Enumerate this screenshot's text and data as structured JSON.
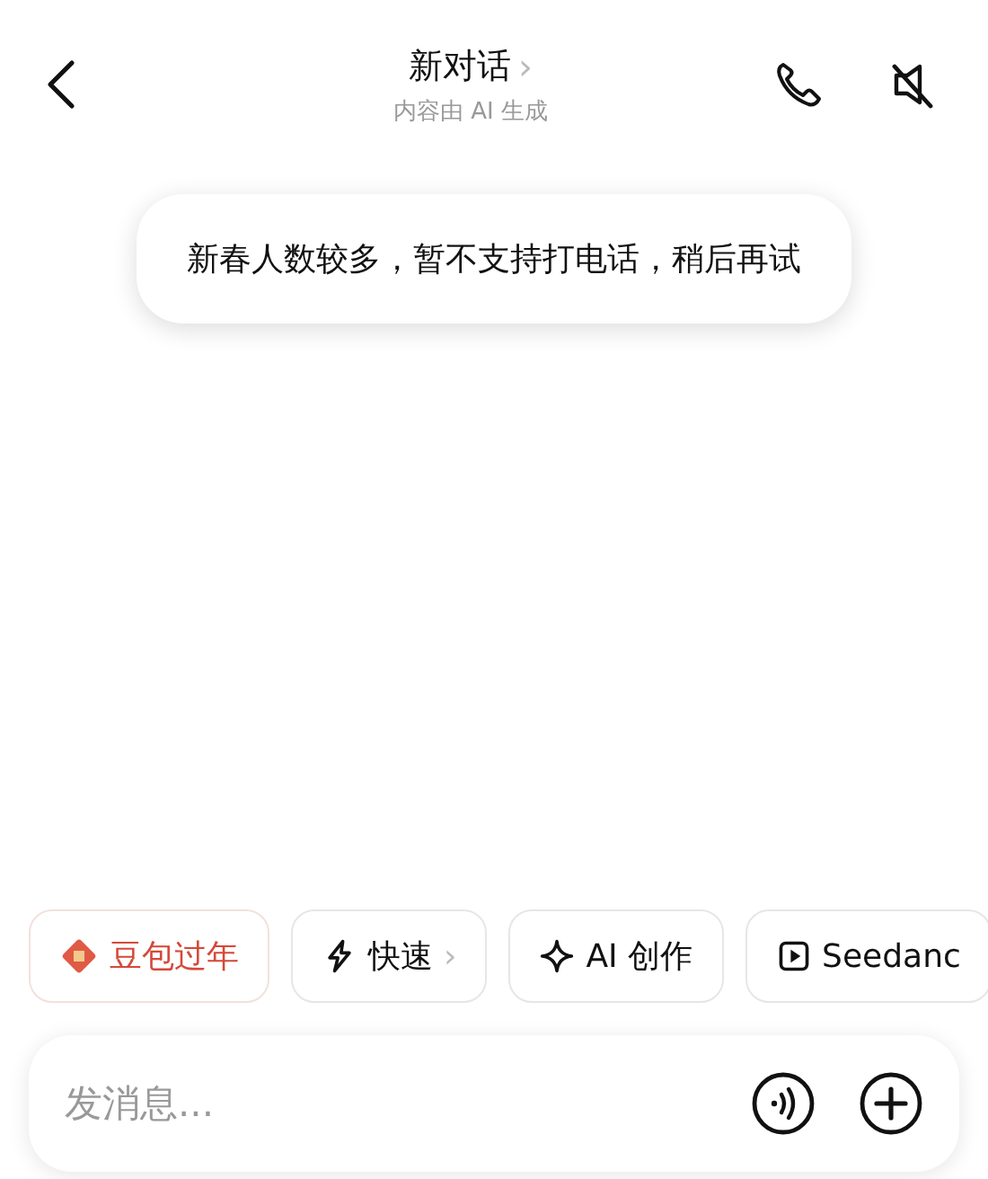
{
  "header": {
    "title": "新对话",
    "title_chevron": "›",
    "subtitle": "内容由 AI 生成"
  },
  "toast": {
    "text": "新春人数较多，暂不支持打电话，稍后再试"
  },
  "chips": [
    {
      "kind": "festive",
      "label": "豆包过年"
    },
    {
      "kind": "quick",
      "label": "快速",
      "chevron": "›"
    },
    {
      "kind": "create",
      "label": "AI 创作"
    },
    {
      "kind": "video",
      "label": "Seedanc"
    }
  ],
  "composer": {
    "placeholder": "发消息..."
  }
}
